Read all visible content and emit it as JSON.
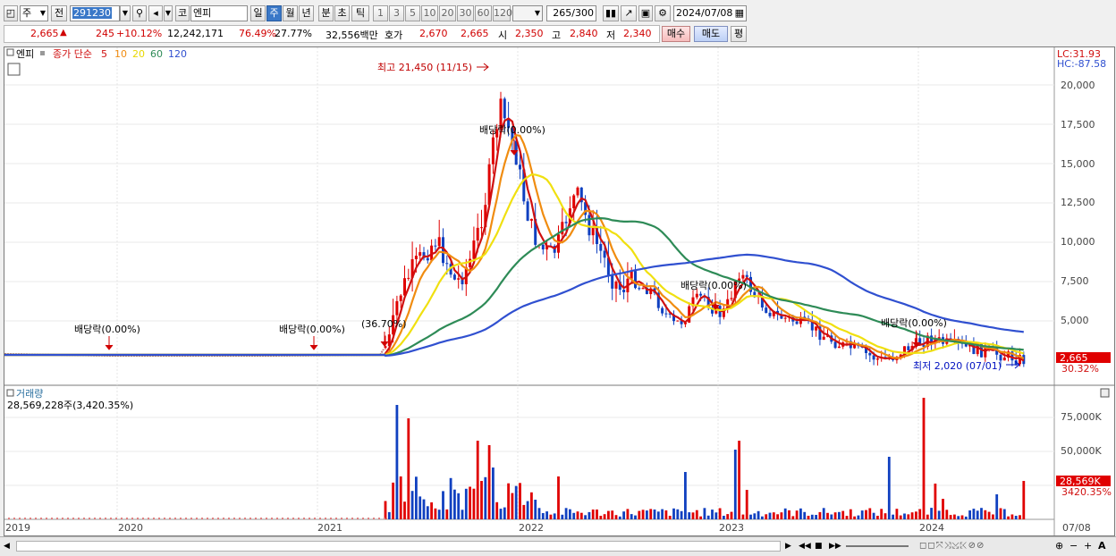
{
  "toolbar": {
    "market": "주",
    "prev_label": "전",
    "code": "291230",
    "market2": "코",
    "name": "엔피",
    "periods": [
      "일",
      "주",
      "월",
      "년",
      "분",
      "초",
      "틱"
    ],
    "active_period": "주",
    "intervals": [
      "1",
      "3",
      "5",
      "10",
      "20",
      "30",
      "60",
      "120"
    ],
    "count": "265",
    "count_total": "/300",
    "date": "2024/07/08"
  },
  "quote": {
    "price": "2,665",
    "change": "245",
    "change_pct": "+10.12%",
    "volume": "12,242,171",
    "ratio1": "76.49%",
    "ratio2": "27.77%",
    "amount": "32,556백만",
    "bid_label": "호가",
    "ask": "2,670",
    "bid": "2,665",
    "open_label": "시",
    "open": "2,350",
    "high_label": "고",
    "high": "2,840",
    "low_label": "저",
    "low": "2,340",
    "buy_label": "매수",
    "sell_label": "매도",
    "eval_label": "평"
  },
  "legend": {
    "stock": "엔피",
    "title": "종가 단순",
    "ma": [
      {
        "label": "5",
        "color": "#d01010"
      },
      {
        "label": "10",
        "color": "#f08c10"
      },
      {
        "label": "20",
        "color": "#f0e010"
      },
      {
        "label": "60",
        "color": "#2e8b57"
      },
      {
        "label": "120",
        "color": "#3050d0"
      }
    ],
    "lc": "LC:31.93",
    "hc": "HC:-87.58"
  },
  "price_axis": [
    "20,000",
    "17,500",
    "15,000",
    "12,500",
    "10,000",
    "7,500",
    "5,000"
  ],
  "annotations": {
    "max": "최고 21,450 (11/15)",
    "min": "최저 2,020 (07/01)",
    "div1": "배당락(0.00%)",
    "div2": "배당락(0.00%)",
    "div3": "배당락(0.00%)",
    "div4": "배당락(0.00%)",
    "div5": "배당락(0.00%)",
    "split": "(36.70%)"
  },
  "price_tag": {
    "value": "2,665",
    "pct": "30.32%"
  },
  "volume_panel": {
    "title": "거래량",
    "info": "28,569,228주(3,420.35%)",
    "axis": [
      "75,000K",
      "50,000K"
    ],
    "tag_value": "28,569K",
    "tag_pct": "3420.35%"
  },
  "x_axis": [
    "2019",
    "2020",
    "2021",
    "2022",
    "2023",
    "2024",
    "07/08"
  ]
}
